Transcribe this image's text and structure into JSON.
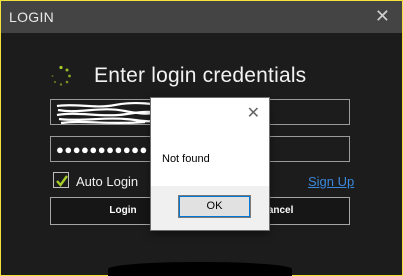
{
  "window": {
    "title": "LOGIN",
    "close_glyph": "✕"
  },
  "heading": "Enter login credentials",
  "username": {
    "value_redacted": true
  },
  "password": {
    "masked_value": "●●●●●●●●●●●"
  },
  "auto_login": {
    "label": "Auto Login",
    "checked": true
  },
  "signup_link": "Sign Up",
  "buttons": {
    "login": "Login",
    "cancel": "Cancel"
  },
  "dialog": {
    "message": "Not found",
    "ok_label": "OK",
    "close_glyph": "✕"
  },
  "colors": {
    "accent_check": "#a5cc2a",
    "link": "#3b87d9",
    "border": "#f2e23a"
  }
}
